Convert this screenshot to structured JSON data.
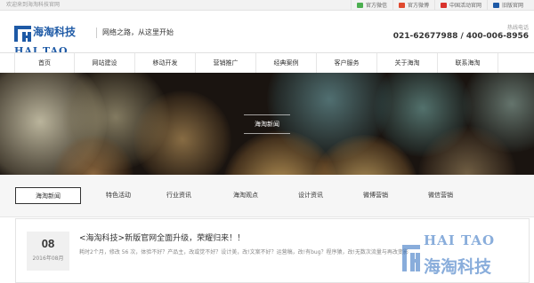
{
  "topbar": {
    "welcome": "欢迎来到海淘科技官网",
    "links": [
      {
        "label": "官方微信",
        "icon": "wechat-icon",
        "color": "#4caf50"
      },
      {
        "label": "官方微博",
        "icon": "weibo-icon",
        "color": "#e04a2f"
      },
      {
        "label": "中国活动官网",
        "icon": "event-site-icon",
        "color": "#d9322c"
      },
      {
        "label": "旧版官网",
        "icon": "old-site-icon",
        "color": "#1e5aa6"
      }
    ]
  },
  "header": {
    "logo_cn": "海淘科技",
    "logo_en": "HAI TAO",
    "slogan": "网络之路，从这里开始",
    "hotline_label": "热线电话",
    "hotline": "021-62677988 / 400-006-8956"
  },
  "nav": {
    "items": [
      "首页",
      "网站建设",
      "移动开发",
      "营销推广",
      "经典案例",
      "客户服务",
      "关于海淘",
      "联系海淘"
    ]
  },
  "banner": {
    "title": "海淘新闻"
  },
  "tabs": {
    "items": [
      "海淘新闻",
      "特色活动",
      "行业资讯",
      "海淘观点",
      "设计资讯",
      "微博营销",
      "微信营销"
    ],
    "active_index": 0
  },
  "article": {
    "day": "08",
    "year_month": "2016年08月",
    "title": "<海淘科技>新版官网全面升级，荣耀归来！！",
    "summary": "耗时2个月，修改 56 次，体验不好？产品主，改或觉不好？设计美，改!文案不好？运营稿，改!有bug？程序猿，改!无数次流量与再改变影的..."
  },
  "watermark": {
    "en": "HAI TAO",
    "cn": "海淘科技"
  }
}
